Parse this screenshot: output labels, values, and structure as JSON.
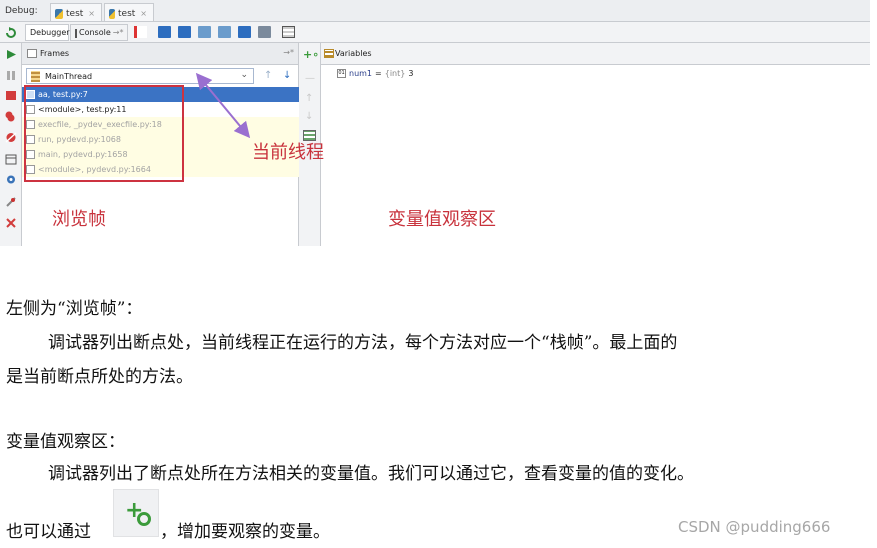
{
  "debug_bar": {
    "label": "Debug:",
    "run_tabs": [
      {
        "label": "test",
        "close": "×"
      },
      {
        "label": "test",
        "close": "×"
      }
    ]
  },
  "toolbar": {
    "debugger_tab": "Debugger",
    "console_tab": "Console",
    "console_suffix": "→*"
  },
  "frames_panel": {
    "title": "Frames",
    "pin": "→*",
    "thread": "MainThread",
    "frames": [
      {
        "label": "aa, test.py:7",
        "state": "selected"
      },
      {
        "label": "<module>, test.py:11",
        "state": "normal"
      },
      {
        "label": "execfile, _pydev_execfile.py:18",
        "state": "lib"
      },
      {
        "label": "run, pydevd.py:1068",
        "state": "lib"
      },
      {
        "label": "main, pydevd.py:1658",
        "state": "lib"
      },
      {
        "label": "<module>, pydevd.py:1664",
        "state": "lib"
      }
    ]
  },
  "variables_panel": {
    "title": "Variables",
    "items": [
      {
        "icon": "01",
        "name": "num1",
        "eq": "=",
        "type": "{int}",
        "value": "3"
      }
    ]
  },
  "annotations": {
    "thread": "当前线程",
    "frames": "浏览帧",
    "variables": "变量值观察区"
  },
  "text": {
    "p1": "左侧为“浏览帧”：",
    "p2": "调试器列出断点处，当前线程正在运行的方法，每个方法对应一个“栈帧”。最上面的",
    "p3": "是当前断点所处的方法。",
    "p4": "变量值观察区：",
    "p5": "调试器列出了断点处所在方法相关的变量值。我们可以通过它，查看变量的值的变化。",
    "p6a": "也可以通过",
    "p6b": "，增加要观察的变量。"
  },
  "watermark": "CSDN @pudding666",
  "colors": {
    "annotation_red": "#c8323c",
    "arrow_purple": "#9a6fd0",
    "selection_blue": "#3b73c4"
  }
}
